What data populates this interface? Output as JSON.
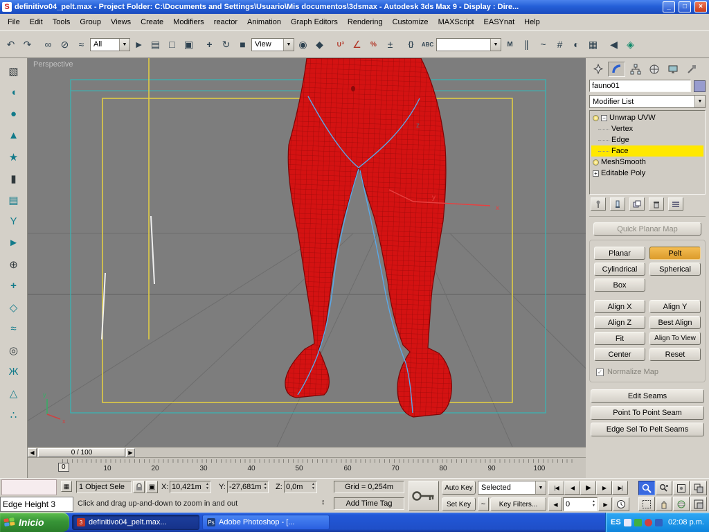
{
  "window": {
    "app_icon_letter": "S",
    "title": "definitivo04_pelt.max     - Project Folder: C:\\Documents and Settings\\Usuario\\Mis documentos\\3dsmax     - Autodesk 3ds Max 9     - Display : Dire...",
    "minimize": "_",
    "maximize": "□",
    "close": "×"
  },
  "menu": {
    "items": [
      "File",
      "Edit",
      "Tools",
      "Group",
      "Views",
      "Create",
      "Modifiers",
      "reactor",
      "Animation",
      "Graph Editors",
      "Rendering",
      "Customize",
      "MAXScript",
      "EASYnat",
      "Help"
    ]
  },
  "toolbar": {
    "selection_filter": "All",
    "coord_system": "View",
    "named_selection": "",
    "icons": [
      {
        "name": "undo",
        "glyph": "↶"
      },
      {
        "name": "redo",
        "glyph": "↷"
      },
      {
        "name": "select-and-link",
        "glyph": "∞"
      },
      {
        "name": "unlink-selection",
        "glyph": "⊘"
      },
      {
        "name": "bind-to-space-warp",
        "glyph": "≈"
      },
      {
        "name": "select-object",
        "glyph": "►"
      },
      {
        "name": "select-by-name",
        "glyph": "▤"
      },
      {
        "name": "rectangular-selection-region",
        "glyph": "□"
      },
      {
        "name": "window-crossing",
        "glyph": "▣"
      },
      {
        "name": "select-and-move",
        "glyph": "+"
      },
      {
        "name": "select-and-rotate",
        "glyph": "↻"
      },
      {
        "name": "select-and-scale",
        "glyph": "■"
      },
      {
        "name": "use-pivot-point-center",
        "glyph": "◉"
      },
      {
        "name": "select-and-manipulate",
        "glyph": "◆"
      },
      {
        "name": "snaps-toggle",
        "glyph": "∪³"
      },
      {
        "name": "angle-snap",
        "glyph": "∠"
      },
      {
        "name": "percent-snap",
        "glyph": "%"
      },
      {
        "name": "spinner-snap",
        "glyph": "±"
      },
      {
        "name": "edit-named-selection-sets",
        "glyph": "{}"
      },
      {
        "name": "named-selection-abc",
        "glyph": "ABC"
      },
      {
        "name": "mirror",
        "glyph": "M"
      },
      {
        "name": "align",
        "glyph": "∥"
      },
      {
        "name": "curve-editor",
        "glyph": "~"
      },
      {
        "name": "schematic-view",
        "glyph": "#"
      },
      {
        "name": "material-editor",
        "glyph": "◐"
      },
      {
        "name": "render-setup",
        "glyph": "▦"
      },
      {
        "name": "keyboard-override",
        "glyph": "◀"
      },
      {
        "name": "axis-constraint",
        "glyph": "◈"
      }
    ]
  },
  "left_toolbar": {
    "icons": [
      {
        "name": "geometry-cube",
        "glyph": "▧"
      },
      {
        "name": "teapot",
        "glyph": "◖"
      },
      {
        "name": "sphere",
        "glyph": "●"
      },
      {
        "name": "cone",
        "glyph": "▲"
      },
      {
        "name": "star-shape",
        "glyph": "★"
      },
      {
        "name": "plane",
        "glyph": "▮"
      },
      {
        "name": "cylinder-stack",
        "glyph": "▤"
      },
      {
        "name": "bones",
        "glyph": "Y"
      },
      {
        "name": "pointer",
        "glyph": "►"
      },
      {
        "name": "ring-gear",
        "glyph": "⊕"
      },
      {
        "name": "cross-tool",
        "glyph": "+"
      },
      {
        "name": "diamond-tool",
        "glyph": "◇"
      },
      {
        "name": "waves",
        "glyph": "≈"
      },
      {
        "name": "shell",
        "glyph": "◎"
      },
      {
        "name": "biped",
        "glyph": "Ж"
      },
      {
        "name": "terrain",
        "glyph": "△"
      },
      {
        "name": "footsteps",
        "glyph": "∴"
      }
    ]
  },
  "viewport": {
    "label": "Perspective",
    "axis": {
      "x": "x",
      "y": "y",
      "z": "z"
    }
  },
  "command_panel": {
    "object_name": "fauno01",
    "modifier_list": "Modifier List",
    "stack": [
      {
        "label": "Unwrap UVW",
        "expand": "−"
      },
      {
        "label": "Vertex"
      },
      {
        "label": "Edge"
      },
      {
        "label": "Face"
      },
      {
        "label": "MeshSmooth"
      },
      {
        "label": "Editable Poly",
        "expand": "+"
      }
    ],
    "rollout": {
      "quick_planar": "Quick Planar Map",
      "planar": "Planar",
      "pelt": "Pelt",
      "cylindrical": "Cylindrical",
      "spherical": "Spherical",
      "box": "Box",
      "align_x": "Align X",
      "align_y": "Align Y",
      "align_z": "Align Z",
      "best_align": "Best Align",
      "fit": "Fit",
      "align_to_view": "Align To View",
      "center": "Center",
      "reset": "Reset",
      "normalize": "Normalize Map",
      "edit_seams": "Edit Seams",
      "p2p_seam": "Point To Point Seam",
      "edge_sel": "Edge Sel To Pelt Seams"
    }
  },
  "timeline": {
    "slider": "0 / 100",
    "ticks": [
      "0",
      "10",
      "20",
      "30",
      "40",
      "50",
      "60",
      "70",
      "80",
      "90",
      "100"
    ]
  },
  "status": {
    "selection": "1 Object Sele",
    "x_label": "X:",
    "x": "10,421m",
    "y_label": "Y:",
    "y": "-27,681m",
    "z_label": "Z:",
    "z": "0,0m",
    "grid": "Grid = 0,254m",
    "prompt": "Click and drag up-and-down to zoom in and out",
    "add_time_tag": "Add Time Tag",
    "auto_key": "Auto Key",
    "set_key": "Set Key",
    "key_mode": "Selected",
    "key_filters": "Key Filters...",
    "frame": "0",
    "playback": [
      "|◀",
      "◀",
      "▶",
      "▶",
      "▶|"
    ],
    "frame_prev": "◀",
    "frame_next": "▶",
    "updown": "↕"
  },
  "fragment": {
    "label": "Edge Height 3"
  },
  "taskbar": {
    "start": "Inicio",
    "tasks": [
      "definitivo04_pelt.max...",
      "Adobe Photoshop - [..."
    ],
    "language": "ES",
    "clock": "02:08 p.m."
  }
}
